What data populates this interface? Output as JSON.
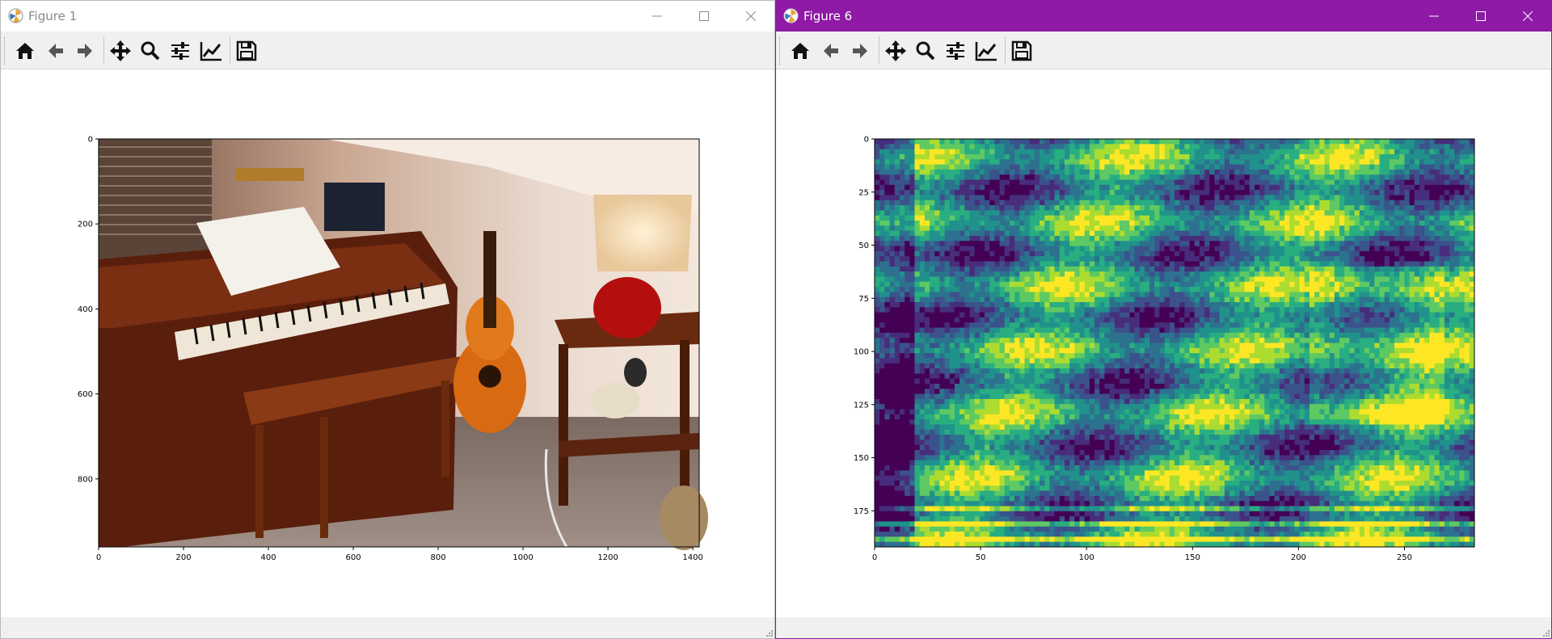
{
  "figure1": {
    "title": "Figure 1",
    "toolbar": [
      "home-icon",
      "back-arrow-icon",
      "forward-arrow-icon",
      "pan-icon",
      "zoom-icon",
      "subplots-config-icon",
      "edit-axes-icon",
      "save-icon"
    ],
    "plot": {
      "kind": "image",
      "subject": "photograph of an upright piano with bench, acoustic guitar, lamp on side table",
      "xticks": [
        "0",
        "200",
        "400",
        "600",
        "800",
        "1000",
        "1200",
        "1400"
      ],
      "yticks": [
        "0",
        "200",
        "400",
        "600",
        "800"
      ],
      "xlim": [
        0,
        1415
      ],
      "ylim": [
        960,
        0
      ]
    }
  },
  "figure6": {
    "title": "Figure 6",
    "toolbar": [
      "home-icon",
      "back-arrow-icon",
      "forward-arrow-icon",
      "pan-icon",
      "zoom-icon",
      "subplots-config-icon",
      "edit-axes-icon",
      "save-icon"
    ],
    "plot": {
      "kind": "heatmap",
      "colormap": "viridis",
      "xticks": [
        "0",
        "50",
        "100",
        "150",
        "200",
        "250"
      ],
      "yticks": [
        "0",
        "25",
        "50",
        "75",
        "100",
        "125",
        "150",
        "175"
      ],
      "xlim": [
        0,
        283
      ],
      "ylim": [
        192,
        0
      ]
    }
  },
  "colors": {
    "fig6_titlebar": "#8e1aa6",
    "toolbar_bg": "#f0f0f0"
  }
}
